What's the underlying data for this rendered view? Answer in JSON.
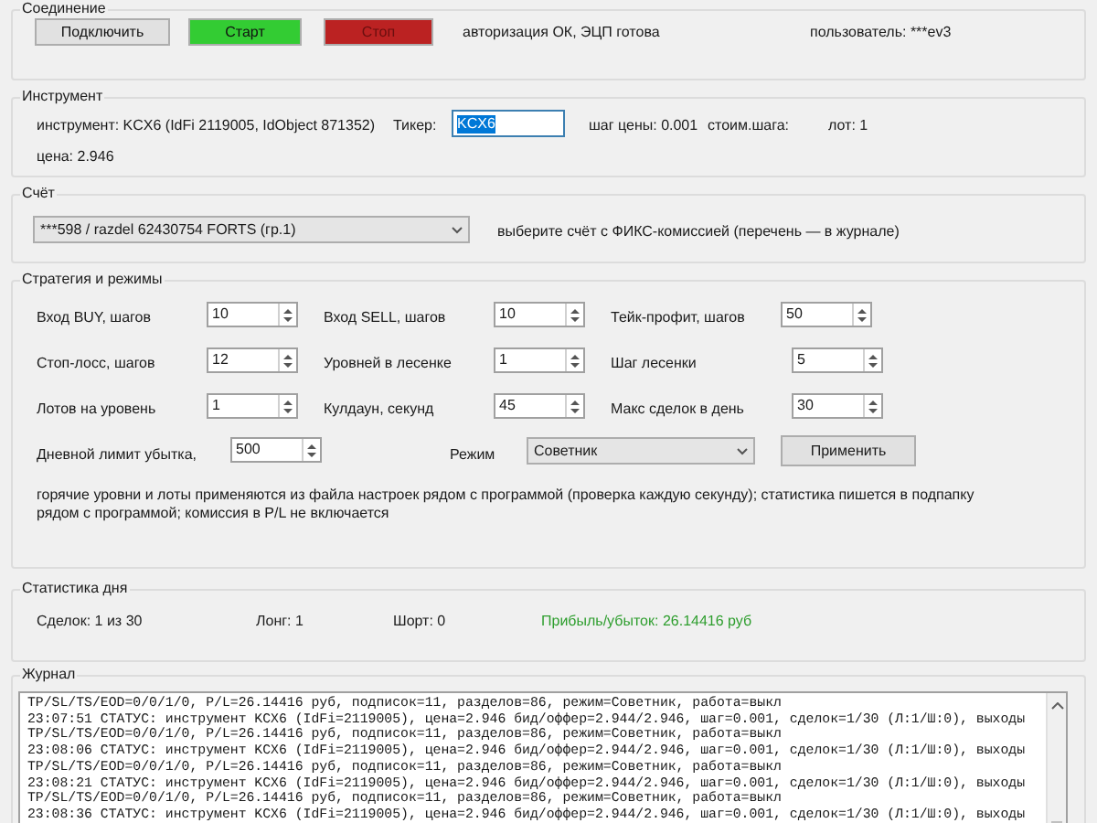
{
  "connection": {
    "title": "Соединение",
    "buttons": [
      {
        "label": "Подключить",
        "color": "#e1e1e1"
      },
      {
        "label": "Старт",
        "color": "#33cc33"
      },
      {
        "label": "Стоп",
        "color": "#bb2222"
      }
    ],
    "status": "авторизация ОК, ЭЦП готова",
    "user": "пользователь: ***ev3"
  },
  "instrument": {
    "title": "Инструмент",
    "info": "инструмент: KCX6 (IdFi 2119005, IdObject 871352)",
    "ticker_label": "Тикер:",
    "ticker_value": "KCX6",
    "ticker_text_selected": true,
    "price_step": "шаг цены: 0.001",
    "step_cost": "стоим.шага:",
    "lot": "лот: 1",
    "price": "цена: 2.946"
  },
  "account": {
    "title": "Счёт",
    "value": "***598 / razdel 62430754  FORTS (гр.1)",
    "hint": "выберите счёт с ФИКС-комиссией (перечень — в журнале)"
  },
  "strategy": {
    "title": "Стратегия и режимы",
    "params": [
      {
        "label": "Вход BUY, шагов",
        "value": "10"
      },
      {
        "label": "Вход SELL, шагов",
        "value": "10"
      },
      {
        "label": "Тейк-профит, шагов",
        "value": "50"
      },
      {
        "label": "Стоп-лосс, шагов",
        "value": "12"
      },
      {
        "label": "Уровней в лесенке",
        "value": "1"
      },
      {
        "label": "Шаг лесенки",
        "value": "5"
      },
      {
        "label": "Лотов на уровень",
        "value": "1"
      },
      {
        "label": "Кулдаун, секунд",
        "value": "45"
      },
      {
        "label": "Макс сделок в день",
        "value": "30"
      }
    ],
    "loss_limit_label": "Дневной лимит убытка,",
    "loss_limit_value": "500",
    "mode_label": "Режим",
    "mode_value": "Советник",
    "apply_button": "Применить",
    "note": "горячие уровни и лоты применяются из файла настроек рядом с программой (проверка каждую секунду); статистика пишется в подпапку рядом с программой; комиссия в P/L не включается"
  },
  "stats": {
    "title": "Статистика дня",
    "items": [
      {
        "text": "Сделок: 1 из 30",
        "color": "#202020"
      },
      {
        "text": "Лонг: 1",
        "color": "#202020"
      },
      {
        "text": "Шорт: 0",
        "color": "#202020"
      },
      {
        "text": "Прибыль/убыток: 26.14416 руб",
        "color": "#2e9e2e"
      }
    ]
  },
  "journal": {
    "title": "Журнал",
    "lines": [
      "TP/SL/TS/EOD=0/0/1/0, P/L=26.14416 руб, подписок=11, разделов=86, режим=Советник, работа=выкл",
      "23:07:51  СТАТУС: инструмент KCX6 (IdFi=2119005), цена=2.946 бид/оффер=2.944/2.946, шаг=0.001, сделок=1/30 (Л:1/Ш:0), выходы",
      "TP/SL/TS/EOD=0/0/1/0, P/L=26.14416 руб, подписок=11, разделов=86, режим=Советник, работа=выкл",
      "23:08:06  СТАТУС: инструмент KCX6 (IdFi=2119005), цена=2.946 бид/оффер=2.944/2.946, шаг=0.001, сделок=1/30 (Л:1/Ш:0), выходы",
      "TP/SL/TS/EOD=0/0/1/0, P/L=26.14416 руб, подписок=11, разделов=86, режим=Советник, работа=выкл",
      "23:08:21  СТАТУС: инструмент KCX6 (IdFi=2119005), цена=2.946 бид/оффер=2.944/2.946, шаг=0.001, сделок=1/30 (Л:1/Ш:0), выходы",
      "TP/SL/TS/EOD=0/0/1/0, P/L=26.14416 руб, подписок=11, разделов=86, режим=Советник, работа=выкл",
      "23:08:36  СТАТУС: инструмент KCX6 (IdFi=2119005), цена=2.946 бид/оффер=2.944/2.946, шаг=0.001, сделок=1/30 (Л:1/Ш:0), выходы"
    ]
  }
}
